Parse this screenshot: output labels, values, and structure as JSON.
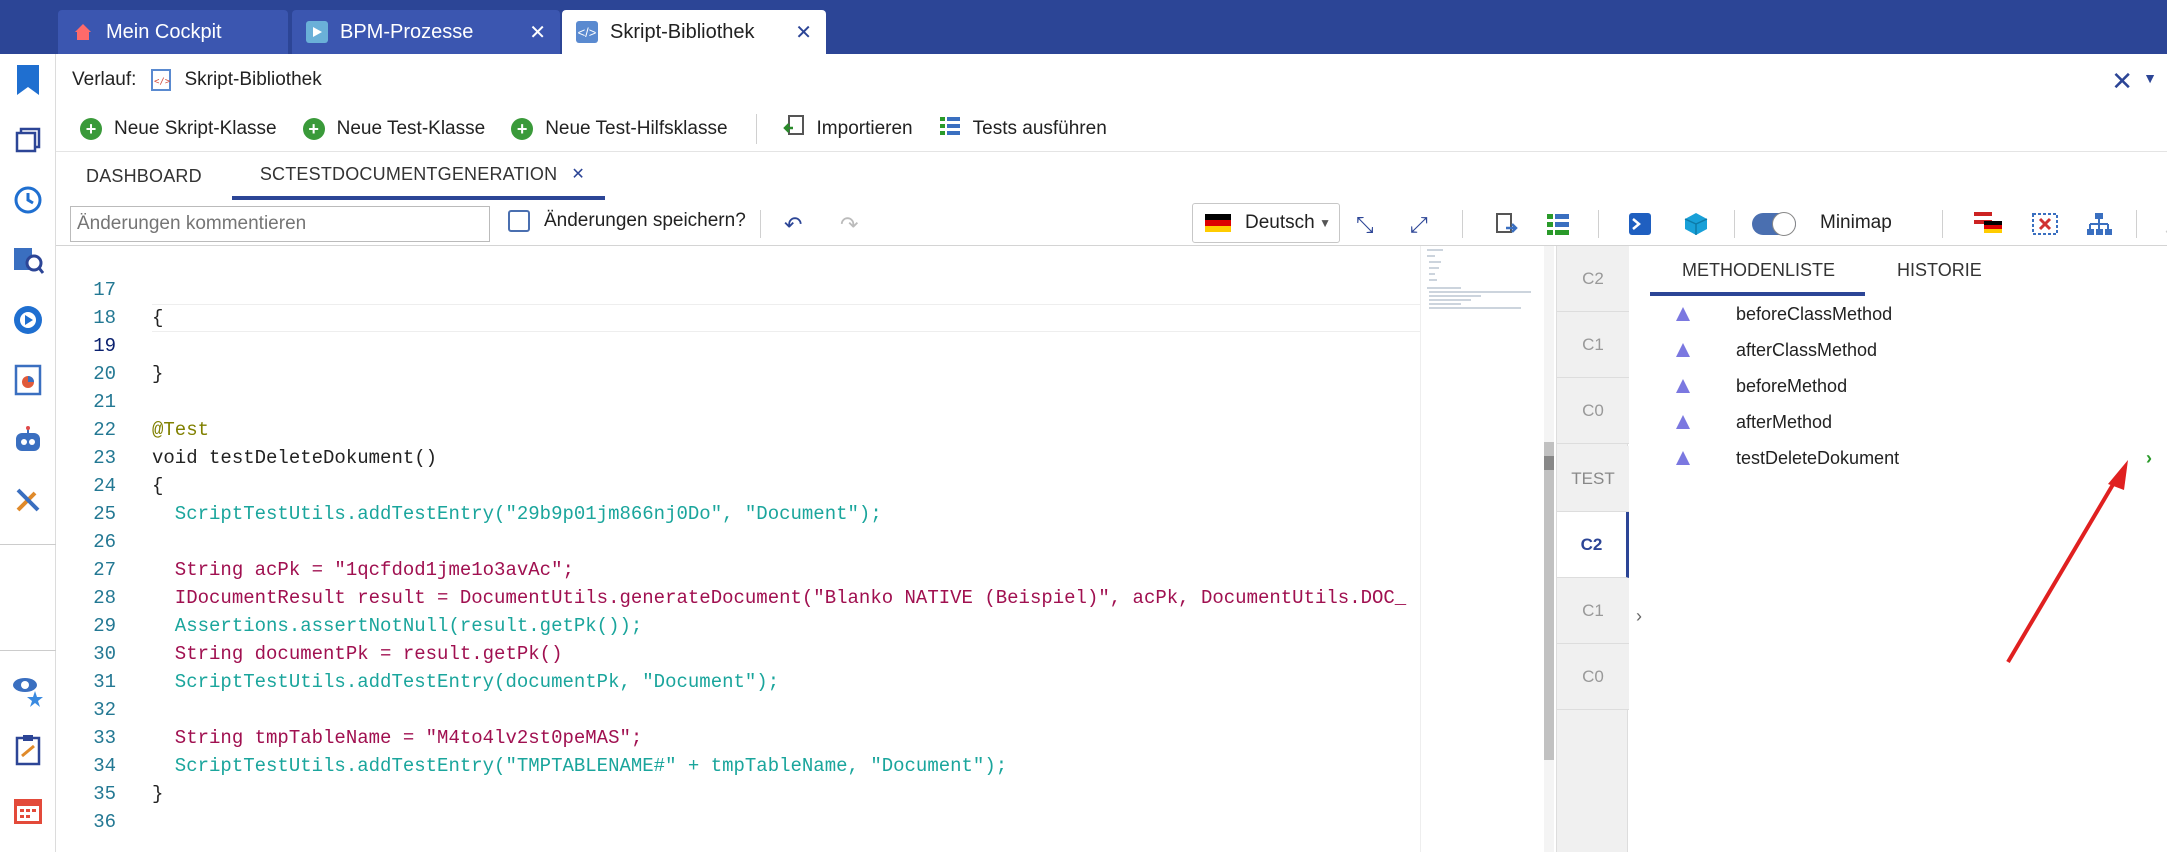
{
  "window_tabs": [
    {
      "label": "Mein Cockpit",
      "icon": "home-icon",
      "active": false
    },
    {
      "label": "BPM-Prozesse",
      "icon": "bpm-play-icon",
      "active": false
    },
    {
      "label": "Skript-Bibliothek",
      "icon": "script-library-icon",
      "active": true
    }
  ],
  "breadcrumb": {
    "label": "Verlauf:",
    "item": "Skript-Bibliothek"
  },
  "toolbar": {
    "new_script_class": "Neue Skript-Klasse",
    "new_test_class": "Neue Test-Klasse",
    "new_test_helper": "Neue Test-Hilfsklasse",
    "import": "Importieren",
    "run_tests": "Tests ausführen"
  },
  "doc_tabs": [
    {
      "label": "DASHBOARD",
      "active": false
    },
    {
      "label": "SCTESTDOCUMENTGENERATION",
      "active": true
    }
  ],
  "editor_toolbar": {
    "comment_placeholder": "Änderungen kommentieren",
    "save_label": "Änderungen speichern?",
    "language": "Deutsch",
    "minimap_label": "Minimap"
  },
  "code_lines": [
    {
      "n": "17",
      "text": "{"
    },
    {
      "n": "18",
      "text": ""
    },
    {
      "n": "19",
      "text": "}"
    },
    {
      "n": "20",
      "text": ""
    },
    {
      "n": "21",
      "text": "@Test"
    },
    {
      "n": "22",
      "text": "void testDeleteDokument()"
    },
    {
      "n": "23",
      "text": "{"
    },
    {
      "n": "24",
      "text": "  ScriptTestUtils.addTestEntry(\"29b9p01jm866nj0Do\", \"Document\");"
    },
    {
      "n": "25",
      "text": ""
    },
    {
      "n": "26",
      "text": "  String acPk = \"1qcfdod1jme1o3avAc\";"
    },
    {
      "n": "27",
      "text": "  IDocumentResult result = DocumentUtils.generateDocument(\"Blanko NATIVE (Beispiel)\", acPk, DocumentUtils.DOC_"
    },
    {
      "n": "28",
      "text": "  Assertions.assertNotNull(result.getPk());"
    },
    {
      "n": "29",
      "text": "  String documentPk = result.getPk()"
    },
    {
      "n": "30",
      "text": "  ScriptTestUtils.addTestEntry(documentPk, \"Document\");"
    },
    {
      "n": "31",
      "text": ""
    },
    {
      "n": "32",
      "text": "  String tmpTableName = \"M4to4lv2st0peMAS\";"
    },
    {
      "n": "33",
      "text": "  ScriptTestUtils.addTestEntry(\"TMPTABLENAME#\" + tmpTableName, \"Document\");"
    },
    {
      "n": "34",
      "text": "}"
    },
    {
      "n": "35",
      "text": ""
    },
    {
      "n": "36",
      "text": ""
    }
  ],
  "levels": [
    "C2",
    "C1",
    "C0",
    "TEST",
    "C2",
    "C1",
    "C0"
  ],
  "right_tabs": [
    "METHODENLISTE",
    "HISTORIE"
  ],
  "methods": [
    "beforeClassMethod",
    "afterClassMethod",
    "beforeMethod",
    "afterMethod",
    "testDeleteDokument"
  ],
  "colors": {
    "brand": "#2c4596",
    "method_marker": "#7b78e0",
    "run_green": "#2a9a2a",
    "annotation_arrow": "#e02020"
  }
}
